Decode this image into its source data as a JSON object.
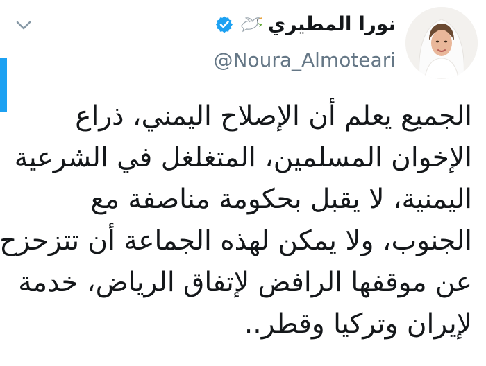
{
  "user": {
    "display_name": "نورا المطيري",
    "handle": "@Noura_Almoteari"
  },
  "icons": {
    "verified": "verified-badge-icon",
    "dove": "dove-emoji-icon",
    "caret": "chevron-down-icon"
  },
  "colors": {
    "verified": "#1da1f2",
    "accent": "#1da1f2",
    "handle": "#657786"
  },
  "tweet": {
    "lines": [
      "الجميع يعلم أن الإصلاح اليمني، ذراع",
      "الإخوان المسلمين، المتغلغل في الشرعية",
      "اليمنية، لا يقبل بحكومة مناصفة مع",
      "الجنوب، ولا يمكن لهذه الجماعة أن تتزحزح",
      "عن موقفها الرافض لإتفاق الرياض، خدمة",
      "لإيران وتركيا وقطر.."
    ]
  }
}
